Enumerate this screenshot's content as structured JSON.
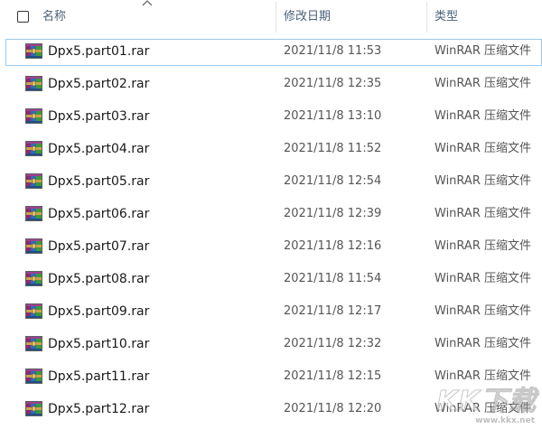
{
  "header": {
    "name_label": "名称",
    "date_label": "修改日期",
    "type_label": "类型"
  },
  "files": [
    {
      "name": "Dpx5.part01.rar",
      "date": "2021/11/8 11:53",
      "type": "WinRAR 压缩文件",
      "selected": true
    },
    {
      "name": "Dpx5.part02.rar",
      "date": "2021/11/8 12:35",
      "type": "WinRAR 压缩文件",
      "selected": false
    },
    {
      "name": "Dpx5.part03.rar",
      "date": "2021/11/8 13:10",
      "type": "WinRAR 压缩文件",
      "selected": false
    },
    {
      "name": "Dpx5.part04.rar",
      "date": "2021/11/8 11:52",
      "type": "WinRAR 压缩文件",
      "selected": false
    },
    {
      "name": "Dpx5.part05.rar",
      "date": "2021/11/8 12:54",
      "type": "WinRAR 压缩文件",
      "selected": false
    },
    {
      "name": "Dpx5.part06.rar",
      "date": "2021/11/8 12:39",
      "type": "WinRAR 压缩文件",
      "selected": false
    },
    {
      "name": "Dpx5.part07.rar",
      "date": "2021/11/8 12:16",
      "type": "WinRAR 压缩文件",
      "selected": false
    },
    {
      "name": "Dpx5.part08.rar",
      "date": "2021/11/8 11:54",
      "type": "WinRAR 压缩文件",
      "selected": false
    },
    {
      "name": "Dpx5.part09.rar",
      "date": "2021/11/8 12:17",
      "type": "WinRAR 压缩文件",
      "selected": false
    },
    {
      "name": "Dpx5.part10.rar",
      "date": "2021/11/8 12:32",
      "type": "WinRAR 压缩文件",
      "selected": false
    },
    {
      "name": "Dpx5.part11.rar",
      "date": "2021/11/8 12:15",
      "type": "WinRAR 压缩文件",
      "selected": false
    },
    {
      "name": "Dpx5.part12.rar",
      "date": "2021/11/8 12:20",
      "type": "WinRAR 压缩文件",
      "selected": false
    }
  ],
  "icons": {
    "file": "winrar-archive-icon",
    "sort": "sort-ascending-icon",
    "checkbox": "select-all-checkbox"
  },
  "watermark": {
    "logo_text": "KK下载",
    "url": "www.kkx.net"
  },
  "colors": {
    "selection_border": "#99c9ef",
    "header_text": "#4c607a"
  }
}
